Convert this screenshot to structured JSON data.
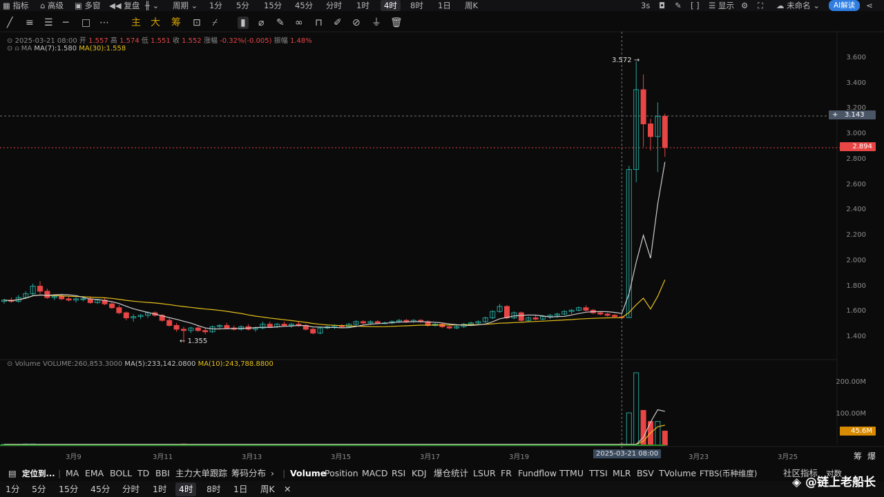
{
  "topbar": {
    "left": [
      "指标",
      "高级",
      "多窗",
      "复盘",
      "",
      "周期"
    ],
    "periods": [
      "1分",
      "5分",
      "15分",
      "45分",
      "分时",
      "1时",
      "4时",
      "8时",
      "1日",
      "周K"
    ],
    "active_period": "4时",
    "right": {
      "interval": "3s",
      "show": "显示",
      "unnamed": "未命名",
      "ai": "AI解读"
    }
  },
  "drawbar": {
    "cn_labels": [
      "主",
      "大",
      "筹"
    ]
  },
  "info": {
    "date": "2025-03-21 08:00",
    "open_label": "开",
    "open": "1.557",
    "high_label": "高",
    "high": "1.574",
    "low_label": "低",
    "low": "1.551",
    "close_label": "收",
    "close": "1.552",
    "change_label": "涨幅",
    "change": "-0.32%(-0.005)",
    "amp_label": "振幅",
    "amp": "1.48%",
    "ma_name": "MA",
    "ma7": "MA(7):1.580",
    "ma30": "MA(30):1.558"
  },
  "volume_info": {
    "name": "Volume",
    "vol": "VOLUME:260,853.3000",
    "ma5": "MA(5):233,142.0800",
    "ma10": "MA(10):243,788.8800"
  },
  "price_axis": [
    "3.600",
    "3.400",
    "3.200",
    "3.000",
    "2.800",
    "2.600",
    "2.400",
    "2.200",
    "2.000",
    "1.800",
    "1.600",
    "1.400"
  ],
  "volume_axis": [
    "200.00M",
    "100.00M"
  ],
  "time_axis": [
    "3月9",
    "3月11",
    "3月13",
    "3月15",
    "3月17",
    "3月19",
    "3月23",
    "3月25"
  ],
  "crosshair_time": "2025-03-21 08:00",
  "tags": {
    "crosshair_price": "3.143",
    "last_price": "2.894",
    "last_volume": "45.6M"
  },
  "annotations": {
    "high": "3.572",
    "low": "1.355"
  },
  "bottom_right": {
    "chips": "筹",
    "burst": "爆"
  },
  "indicator_bar": {
    "locate": "定位到...",
    "main": [
      "MA",
      "EMA",
      "BOLL",
      "TD",
      "BBI",
      "主力大单跟踪",
      "筹码分布"
    ],
    "sub": [
      "Volume",
      "Position",
      "MACD",
      "RSI",
      "KDJ",
      "爆仓统计",
      "LSUR",
      "FR",
      "Fundflow",
      "TTMU",
      "TTSI",
      "MLR",
      "BSV",
      "TVolume",
      "FTBS(币种维度)",
      "社区指标",
      "对数"
    ]
  },
  "period_bar": [
    "1分",
    "5分",
    "15分",
    "45分",
    "分时",
    "1时",
    "4时",
    "8时",
    "1日",
    "周K"
  ],
  "watermark": "@链上老船长",
  "colors": {
    "up": "#26a69a",
    "down": "#e84545",
    "ma7": "#cfcfcf",
    "ma30": "#e8c21a",
    "bg": "#0b0b0c"
  },
  "chart_data": {
    "type": "candlestick",
    "price_range": [
      1.3,
      3.65
    ],
    "volume_range": [
      0,
      235
    ],
    "volume_unit": "M",
    "candles": [
      [
        1.68,
        1.7,
        1.66,
        1.69
      ],
      [
        1.69,
        1.71,
        1.67,
        1.68
      ],
      [
        1.68,
        1.73,
        1.67,
        1.71
      ],
      [
        1.71,
        1.76,
        1.7,
        1.74
      ],
      [
        1.74,
        1.82,
        1.72,
        1.8
      ],
      [
        1.8,
        1.84,
        1.74,
        1.76
      ],
      [
        1.76,
        1.78,
        1.7,
        1.71
      ],
      [
        1.71,
        1.73,
        1.69,
        1.72
      ],
      [
        1.72,
        1.74,
        1.69,
        1.7
      ],
      [
        1.7,
        1.72,
        1.68,
        1.69
      ],
      [
        1.69,
        1.71,
        1.67,
        1.7
      ],
      [
        1.7,
        1.72,
        1.68,
        1.7
      ],
      [
        1.7,
        1.72,
        1.66,
        1.67
      ],
      [
        1.67,
        1.7,
        1.66,
        1.69
      ],
      [
        1.69,
        1.71,
        1.65,
        1.66
      ],
      [
        1.66,
        1.68,
        1.62,
        1.63
      ],
      [
        1.63,
        1.65,
        1.58,
        1.59
      ],
      [
        1.59,
        1.6,
        1.53,
        1.55
      ],
      [
        1.55,
        1.58,
        1.52,
        1.56
      ],
      [
        1.56,
        1.58,
        1.54,
        1.57
      ],
      [
        1.57,
        1.6,
        1.55,
        1.59
      ],
      [
        1.59,
        1.6,
        1.56,
        1.57
      ],
      [
        1.57,
        1.58,
        1.52,
        1.53
      ],
      [
        1.53,
        1.55,
        1.48,
        1.49
      ],
      [
        1.49,
        1.51,
        1.44,
        1.46
      ],
      [
        1.46,
        1.48,
        1.355,
        1.45
      ],
      [
        1.45,
        1.48,
        1.43,
        1.47
      ],
      [
        1.47,
        1.49,
        1.44,
        1.45
      ],
      [
        1.45,
        1.47,
        1.42,
        1.44
      ],
      [
        1.44,
        1.49,
        1.43,
        1.48
      ],
      [
        1.48,
        1.5,
        1.46,
        1.49
      ],
      [
        1.49,
        1.51,
        1.46,
        1.47
      ],
      [
        1.47,
        1.49,
        1.45,
        1.46
      ],
      [
        1.46,
        1.49,
        1.45,
        1.48
      ],
      [
        1.48,
        1.5,
        1.45,
        1.46
      ],
      [
        1.46,
        1.48,
        1.44,
        1.47
      ],
      [
        1.47,
        1.52,
        1.46,
        1.5
      ],
      [
        1.5,
        1.52,
        1.47,
        1.48
      ],
      [
        1.48,
        1.51,
        1.47,
        1.5
      ],
      [
        1.5,
        1.52,
        1.48,
        1.49
      ],
      [
        1.49,
        1.51,
        1.47,
        1.5
      ],
      [
        1.5,
        1.52,
        1.48,
        1.49
      ],
      [
        1.49,
        1.5,
        1.45,
        1.46
      ],
      [
        1.46,
        1.47,
        1.42,
        1.43
      ],
      [
        1.43,
        1.48,
        1.42,
        1.47
      ],
      [
        1.47,
        1.49,
        1.46,
        1.48
      ],
      [
        1.48,
        1.5,
        1.46,
        1.49
      ],
      [
        1.49,
        1.5,
        1.47,
        1.48
      ],
      [
        1.48,
        1.51,
        1.47,
        1.5
      ],
      [
        1.5,
        1.53,
        1.49,
        1.52
      ],
      [
        1.52,
        1.53,
        1.5,
        1.51
      ],
      [
        1.51,
        1.53,
        1.5,
        1.52
      ],
      [
        1.52,
        1.53,
        1.5,
        1.51
      ],
      [
        1.51,
        1.52,
        1.5,
        1.51
      ],
      [
        1.51,
        1.53,
        1.5,
        1.52
      ],
      [
        1.52,
        1.54,
        1.51,
        1.53
      ],
      [
        1.53,
        1.54,
        1.51,
        1.52
      ],
      [
        1.52,
        1.54,
        1.51,
        1.53
      ],
      [
        1.53,
        1.54,
        1.51,
        1.52
      ],
      [
        1.52,
        1.53,
        1.48,
        1.49
      ],
      [
        1.49,
        1.51,
        1.48,
        1.5
      ],
      [
        1.5,
        1.51,
        1.47,
        1.48
      ],
      [
        1.48,
        1.49,
        1.46,
        1.47
      ],
      [
        1.47,
        1.49,
        1.46,
        1.48
      ],
      [
        1.48,
        1.51,
        1.47,
        1.5
      ],
      [
        1.5,
        1.52,
        1.49,
        1.51
      ],
      [
        1.51,
        1.53,
        1.5,
        1.52
      ],
      [
        1.52,
        1.56,
        1.51,
        1.55
      ],
      [
        1.55,
        1.61,
        1.54,
        1.6
      ],
      [
        1.6,
        1.66,
        1.59,
        1.64
      ],
      [
        1.64,
        1.65,
        1.54,
        1.55
      ],
      [
        1.55,
        1.6,
        1.54,
        1.59
      ],
      [
        1.59,
        1.6,
        1.52,
        1.53
      ],
      [
        1.53,
        1.56,
        1.52,
        1.55
      ],
      [
        1.55,
        1.57,
        1.53,
        1.54
      ],
      [
        1.54,
        1.57,
        1.53,
        1.56
      ],
      [
        1.56,
        1.58,
        1.54,
        1.57
      ],
      [
        1.57,
        1.59,
        1.55,
        1.58
      ],
      [
        1.58,
        1.61,
        1.57,
        1.6
      ],
      [
        1.6,
        1.62,
        1.58,
        1.61
      ],
      [
        1.61,
        1.64,
        1.6,
        1.63
      ],
      [
        1.63,
        1.65,
        1.6,
        1.61
      ],
      [
        1.61,
        1.62,
        1.58,
        1.59
      ],
      [
        1.59,
        1.6,
        1.57,
        1.58
      ],
      [
        1.58,
        1.59,
        1.56,
        1.57
      ],
      [
        1.57,
        1.58,
        1.55,
        1.56
      ],
      [
        1.557,
        1.574,
        1.551,
        1.552
      ],
      [
        1.552,
        2.75,
        1.55,
        2.72
      ],
      [
        2.72,
        3.572,
        2.62,
        3.35
      ],
      [
        3.35,
        3.47,
        2.9,
        3.08
      ],
      [
        3.08,
        3.12,
        2.87,
        2.98
      ],
      [
        2.98,
        3.25,
        2.7,
        3.14
      ],
      [
        3.14,
        3.16,
        2.82,
        2.894
      ]
    ],
    "ma7_tail": [
      2.02,
      2.45,
      2.78
    ],
    "ma30_tail": [
      1.62,
      1.72,
      1.85
    ],
    "volume": [
      3,
      3,
      3,
      4,
      4,
      3,
      3,
      3,
      3,
      3,
      3,
      3,
      3,
      3,
      3,
      3,
      3,
      3,
      3,
      3,
      3,
      3,
      3,
      3,
      3,
      4,
      3,
      3,
      3,
      3,
      3,
      3,
      3,
      3,
      3,
      3,
      3,
      3,
      3,
      3,
      3,
      3,
      3,
      3,
      3,
      3,
      3,
      3,
      3,
      3,
      3,
      3,
      3,
      3,
      3,
      3,
      3,
      3,
      3,
      3,
      3,
      3,
      3,
      3,
      3,
      3,
      3,
      3,
      3,
      3,
      3,
      3,
      3,
      3,
      3,
      3,
      3,
      3,
      3,
      3,
      3,
      3,
      3,
      3,
      3,
      3,
      4,
      105,
      235,
      113,
      77,
      77,
      46
    ],
    "vol_ma5_tail": [
      75,
      115,
      110
    ],
    "vol_ma10_tail": [
      40,
      60,
      65
    ]
  }
}
